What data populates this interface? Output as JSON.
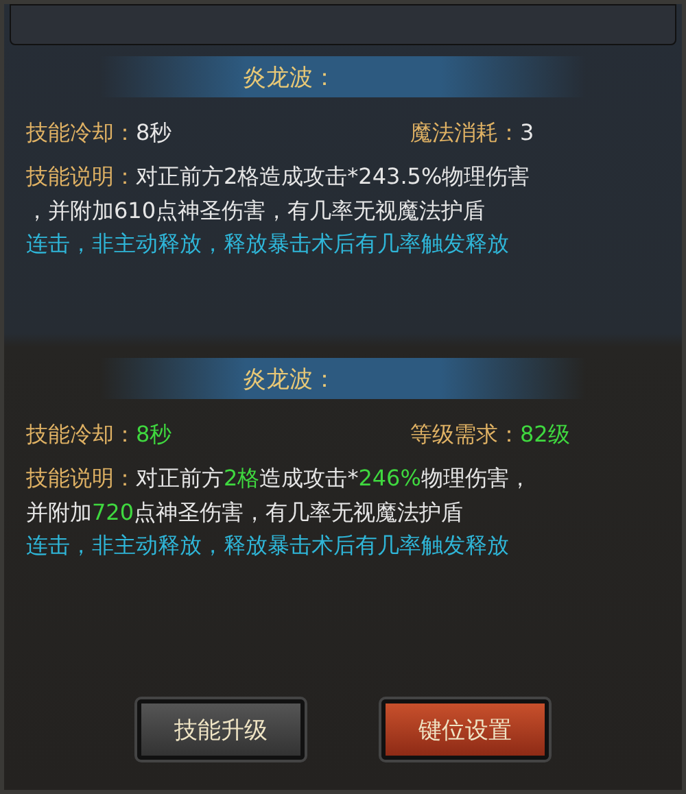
{
  "sections": [
    {
      "title": "炎龙波：",
      "stats": [
        {
          "label": "技能冷却：",
          "value": "8秒",
          "highlight": false
        },
        {
          "label": "魔法消耗：",
          "value": "3",
          "highlight": false
        }
      ],
      "description_label": "技能说明：",
      "description_lines": [
        [
          {
            "text": "对正前方2格造成攻击*243.5%物理伤害",
            "highlight": false
          }
        ],
        [
          {
            "text": "，并附加610点神圣伤害，有几率无视魔法护盾",
            "highlight": false
          }
        ]
      ],
      "note": "连击，非主动释放，释放暴击术后有几率触发释放"
    },
    {
      "title": "炎龙波：",
      "stats": [
        {
          "label": "技能冷却：",
          "value": "8秒",
          "highlight": true
        },
        {
          "label": "等级需求：",
          "value": "82级",
          "highlight": true
        }
      ],
      "description_label": "技能说明：",
      "description_lines": [
        [
          {
            "text": "对正前方",
            "highlight": false
          },
          {
            "text": "2格",
            "highlight": true
          },
          {
            "text": "造成攻击*",
            "highlight": false
          },
          {
            "text": "246%",
            "highlight": true
          },
          {
            "text": "物理伤害，",
            "highlight": false
          }
        ],
        [
          {
            "text": "并附加",
            "highlight": false
          },
          {
            "text": "720",
            "highlight": true
          },
          {
            "text": "点神圣伤害，有几率无视魔法护盾",
            "highlight": false
          }
        ]
      ],
      "note": "连击，非主动释放，释放暴击术后有几率触发释放"
    }
  ],
  "buttons": [
    {
      "label": "技能升级",
      "kind": "gray"
    },
    {
      "label": "键位设置",
      "kind": "red"
    }
  ]
}
